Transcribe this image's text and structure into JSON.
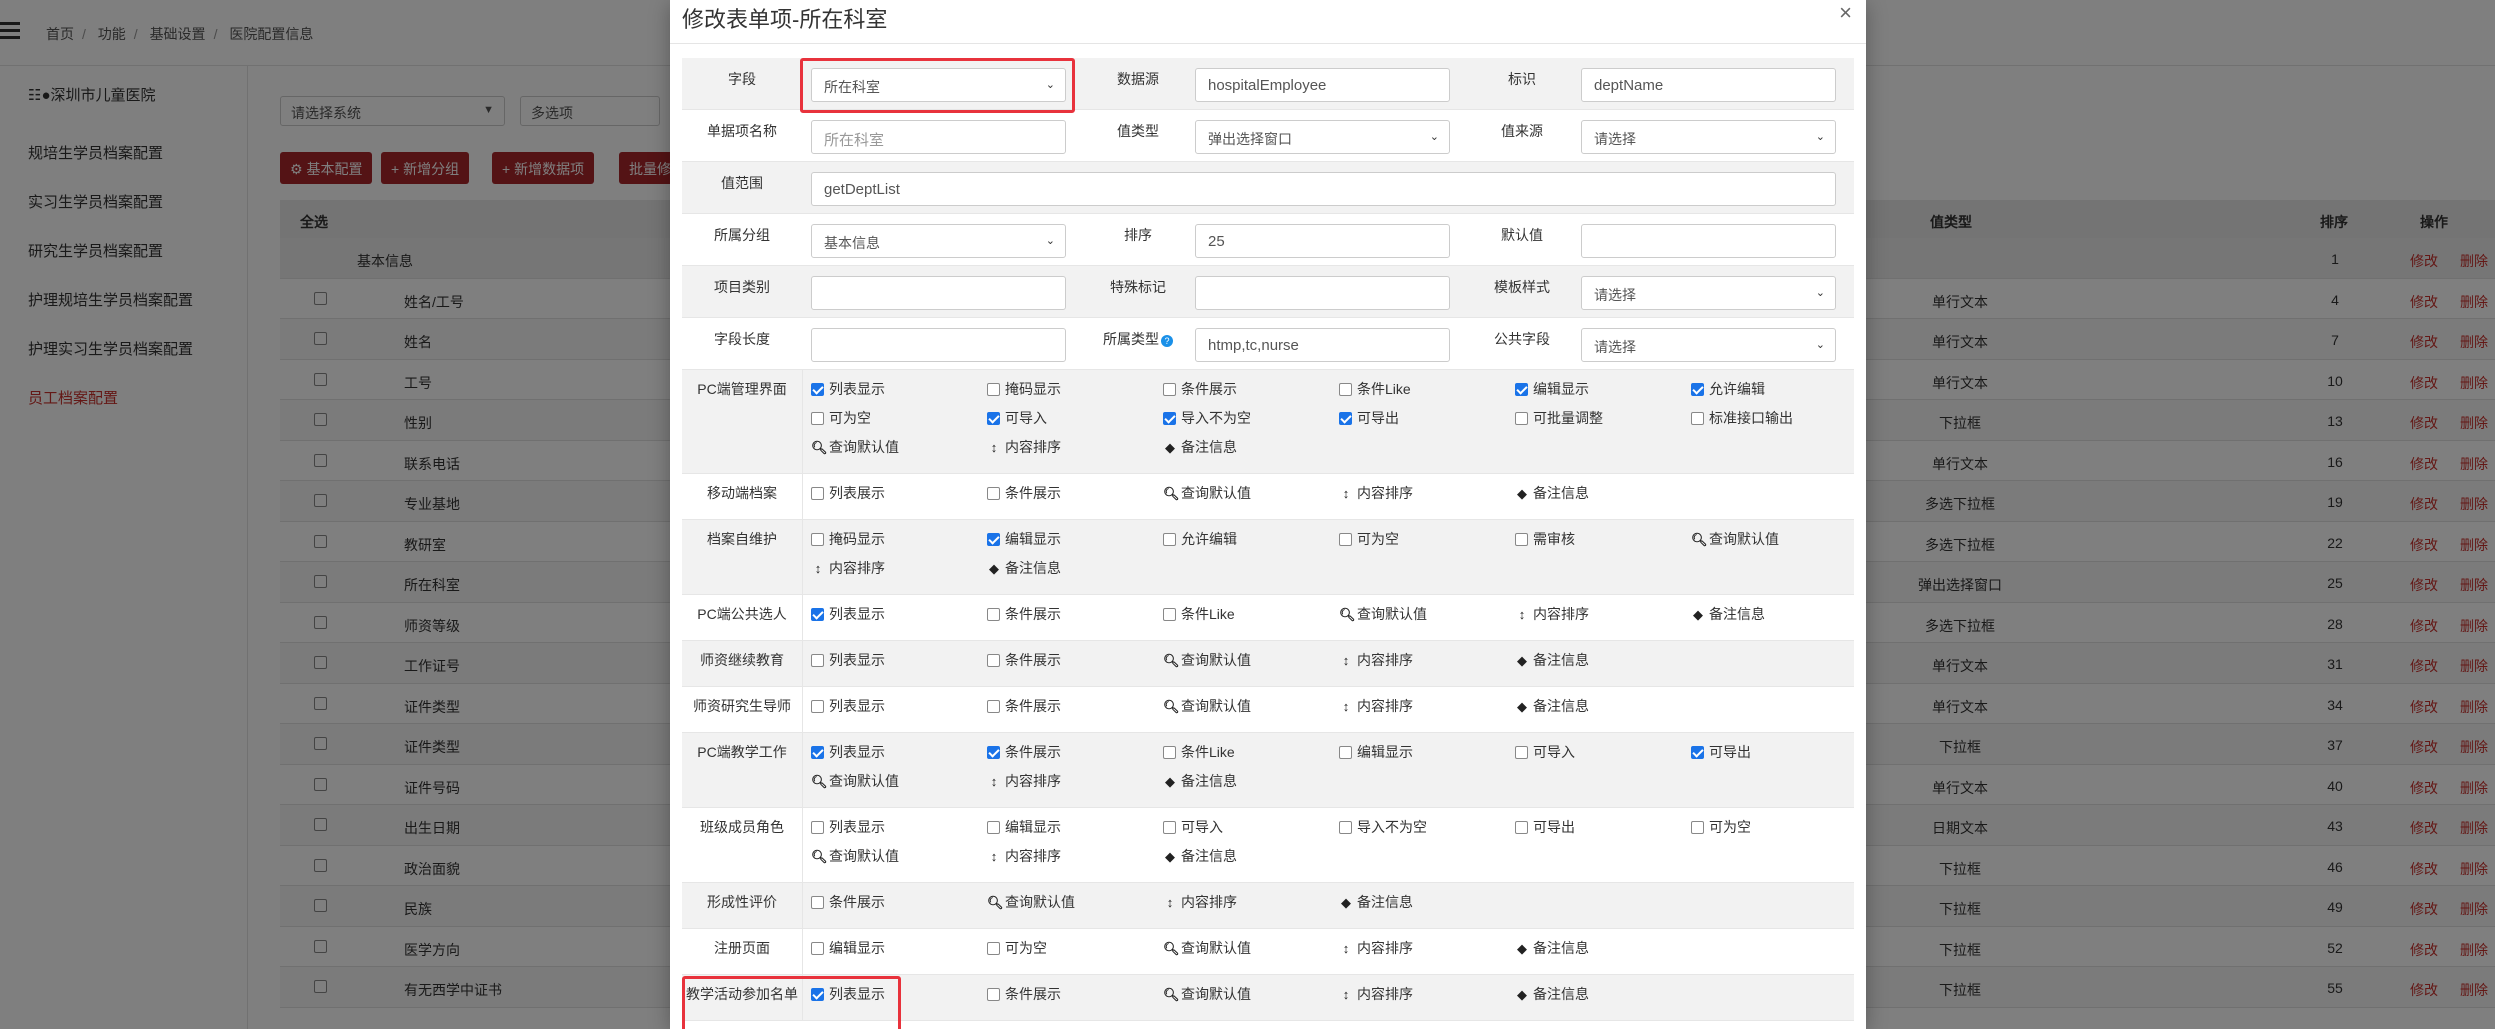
{
  "breadcrumb": [
    "首页",
    "功能",
    "基础设置",
    "医院配置信息"
  ],
  "sidebar": {
    "hospital": "深圳市儿童医院",
    "items": [
      {
        "label": "规培生学员档案配置",
        "active": false
      },
      {
        "label": "实习生学员档案配置",
        "active": false
      },
      {
        "label": "研究生学员档案配置",
        "active": false
      },
      {
        "label": "护理规培生学员档案配置",
        "active": false
      },
      {
        "label": "护理实习生学员档案配置",
        "active": false
      },
      {
        "label": "员工档案配置",
        "active": true
      }
    ]
  },
  "filters": {
    "system": "请选择系统",
    "multi": "多选项"
  },
  "buttons": {
    "basic": "基本配置",
    "add_group": "新增分组",
    "add_data": "新增数据项",
    "batch": "批量修改"
  },
  "table": {
    "headers": {
      "select_all": "全选",
      "value_type": "值类型",
      "sort": "排序",
      "action": "操作"
    },
    "group": {
      "name": "基本信息",
      "sort": "1"
    },
    "edit_label": "修改",
    "delete_label": "删除",
    "rows": [
      {
        "name": "姓名/工号",
        "type": "单行文本",
        "sort": "4"
      },
      {
        "name": "姓名",
        "type": "单行文本",
        "sort": "7"
      },
      {
        "name": "工号",
        "type": "单行文本",
        "sort": "10"
      },
      {
        "name": "性别",
        "type": "下拉框",
        "sort": "13"
      },
      {
        "name": "联系电话",
        "type": "单行文本",
        "sort": "16"
      },
      {
        "name": "专业基地",
        "type": "多选下拉框",
        "sort": "19"
      },
      {
        "name": "教研室",
        "type": "多选下拉框",
        "sort": "22"
      },
      {
        "name": "所在科室",
        "type": "弹出选择窗口",
        "sort": "25"
      },
      {
        "name": "师资等级",
        "type": "多选下拉框",
        "sort": "28"
      },
      {
        "name": "工作证号",
        "type": "单行文本",
        "sort": "31"
      },
      {
        "name": "证件类型",
        "type": "单行文本",
        "sort": "34"
      },
      {
        "name": "证件类型",
        "type": "下拉框",
        "sort": "37"
      },
      {
        "name": "证件号码",
        "type": "单行文本",
        "sort": "40"
      },
      {
        "name": "出生日期",
        "type": "日期文本",
        "sort": "43"
      },
      {
        "name": "政治面貌",
        "type": "下拉框",
        "sort": "46"
      },
      {
        "name": "民族",
        "type": "下拉框",
        "sort": "49"
      },
      {
        "name": "医学方向",
        "type": "下拉框",
        "sort": "52"
      },
      {
        "name": "有无西学中证书",
        "type": "下拉框",
        "sort": "55"
      }
    ]
  },
  "modal": {
    "title": "修改表单项-所在科室",
    "close": "×",
    "fields": {
      "field_label": "字段",
      "field_value": "所在科室",
      "datasource_label": "数据源",
      "datasource_value": "hospitalEmployee",
      "ident_label": "标识",
      "ident_value": "deptName",
      "itemname_label": "单据项名称",
      "itemname_placeholder": "所在科室",
      "valtype_label": "值类型",
      "valtype_value": "弹出选择窗口",
      "valsource_label": "值来源",
      "valsource_value": "请选择",
      "range_label": "值范围",
      "range_value": "getDeptList",
      "group_label": "所属分组",
      "group_value": "基本信息",
      "sort_label": "排序",
      "sort_value": "25",
      "default_label": "默认值",
      "default_value": "",
      "category_label": "项目类别",
      "category_value": "",
      "special_label": "特殊标记",
      "special_value": "",
      "template_label": "模板样式",
      "template_value": "请选择",
      "length_label": "字段长度",
      "length_value": "",
      "ownertype_label": "所属类型",
      "ownertype_value": "htmp,tc,nurse",
      "public_label": "公共字段",
      "public_value": "请选择"
    },
    "sections": [
      {
        "label": "PC端管理界面",
        "opts": [
          {
            "t": "列表显示",
            "k": "cb",
            "on": true
          },
          {
            "t": "掩码显示",
            "k": "cb",
            "on": false
          },
          {
            "t": "条件展示",
            "k": "cb",
            "on": false
          },
          {
            "t": "条件Like",
            "k": "cb",
            "on": false
          },
          {
            "t": "编辑显示",
            "k": "cb",
            "on": true
          },
          {
            "t": "允许编辑",
            "k": "cb",
            "on": true
          },
          {
            "t": "可为空",
            "k": "cb",
            "on": false
          },
          {
            "t": "可导入",
            "k": "cb",
            "on": true
          },
          {
            "t": "导入不为空",
            "k": "cb",
            "on": true
          },
          {
            "t": "可导出",
            "k": "cb",
            "on": true
          },
          {
            "t": "可批量调整",
            "k": "cb",
            "on": false
          },
          {
            "t": "标准接口输出",
            "k": "cb",
            "on": false
          },
          {
            "t": "查询默认值",
            "k": "search"
          },
          {
            "t": "内容排序",
            "k": "sort"
          },
          {
            "t": "备注信息",
            "k": "tag"
          }
        ]
      },
      {
        "label": "移动端档案",
        "opts": [
          {
            "t": "列表展示",
            "k": "cb",
            "on": false
          },
          {
            "t": "条件展示",
            "k": "cb",
            "on": false
          },
          {
            "t": "查询默认值",
            "k": "search"
          },
          {
            "t": "内容排序",
            "k": "sort"
          },
          {
            "t": "备注信息",
            "k": "tag"
          }
        ]
      },
      {
        "label": "档案自维护",
        "opts": [
          {
            "t": "掩码显示",
            "k": "cb",
            "on": false
          },
          {
            "t": "编辑显示",
            "k": "cb",
            "on": true
          },
          {
            "t": "允许编辑",
            "k": "cb",
            "on": false
          },
          {
            "t": "可为空",
            "k": "cb",
            "on": false
          },
          {
            "t": "需审核",
            "k": "cb",
            "on": false
          },
          {
            "t": "查询默认值",
            "k": "search"
          },
          {
            "t": "内容排序",
            "k": "sort"
          },
          {
            "t": "备注信息",
            "k": "tag"
          }
        ]
      },
      {
        "label": "PC端公共选人",
        "opts": [
          {
            "t": "列表显示",
            "k": "cb",
            "on": true
          },
          {
            "t": "条件展示",
            "k": "cb",
            "on": false
          },
          {
            "t": "条件Like",
            "k": "cb",
            "on": false
          },
          {
            "t": "查询默认值",
            "k": "search"
          },
          {
            "t": "内容排序",
            "k": "sort"
          },
          {
            "t": "备注信息",
            "k": "tag"
          }
        ]
      },
      {
        "label": "师资继续教育",
        "opts": [
          {
            "t": "列表显示",
            "k": "cb",
            "on": false
          },
          {
            "t": "条件展示",
            "k": "cb",
            "on": false
          },
          {
            "t": "查询默认值",
            "k": "search"
          },
          {
            "t": "内容排序",
            "k": "sort"
          },
          {
            "t": "备注信息",
            "k": "tag"
          }
        ]
      },
      {
        "label": "师资研究生导师",
        "opts": [
          {
            "t": "列表显示",
            "k": "cb",
            "on": false
          },
          {
            "t": "条件展示",
            "k": "cb",
            "on": false
          },
          {
            "t": "查询默认值",
            "k": "search"
          },
          {
            "t": "内容排序",
            "k": "sort"
          },
          {
            "t": "备注信息",
            "k": "tag"
          }
        ]
      },
      {
        "label": "PC端教学工作",
        "opts": [
          {
            "t": "列表显示",
            "k": "cb",
            "on": true
          },
          {
            "t": "条件展示",
            "k": "cb",
            "on": true
          },
          {
            "t": "条件Like",
            "k": "cb",
            "on": false
          },
          {
            "t": "编辑显示",
            "k": "cb",
            "on": false
          },
          {
            "t": "可导入",
            "k": "cb",
            "on": false
          },
          {
            "t": "可导出",
            "k": "cb",
            "on": true
          },
          {
            "t": "查询默认值",
            "k": "search"
          },
          {
            "t": "内容排序",
            "k": "sort"
          },
          {
            "t": "备注信息",
            "k": "tag"
          }
        ]
      },
      {
        "label": "班级成员角色",
        "opts": [
          {
            "t": "列表显示",
            "k": "cb",
            "on": false
          },
          {
            "t": "编辑显示",
            "k": "cb",
            "on": false
          },
          {
            "t": "可导入",
            "k": "cb",
            "on": false
          },
          {
            "t": "导入不为空",
            "k": "cb",
            "on": false
          },
          {
            "t": "可导出",
            "k": "cb",
            "on": false
          },
          {
            "t": "可为空",
            "k": "cb",
            "on": false
          },
          {
            "t": "查询默认值",
            "k": "search"
          },
          {
            "t": "内容排序",
            "k": "sort"
          },
          {
            "t": "备注信息",
            "k": "tag"
          }
        ]
      },
      {
        "label": "形成性评价",
        "opts": [
          {
            "t": "条件展示",
            "k": "cb",
            "on": false
          },
          {
            "t": "查询默认值",
            "k": "search"
          },
          {
            "t": "内容排序",
            "k": "sort"
          },
          {
            "t": "备注信息",
            "k": "tag"
          }
        ]
      },
      {
        "label": "注册页面",
        "opts": [
          {
            "t": "编辑显示",
            "k": "cb",
            "on": false
          },
          {
            "t": "可为空",
            "k": "cb",
            "on": false
          },
          {
            "t": "查询默认值",
            "k": "search"
          },
          {
            "t": "内容排序",
            "k": "sort"
          },
          {
            "t": "备注信息",
            "k": "tag"
          }
        ]
      },
      {
        "label": "教学活动参加名单",
        "opts": [
          {
            "t": "列表显示",
            "k": "cb",
            "on": true
          },
          {
            "t": "条件展示",
            "k": "cb",
            "on": false
          },
          {
            "t": "查询默认值",
            "k": "search"
          },
          {
            "t": "内容排序",
            "k": "sort"
          },
          {
            "t": "备注信息",
            "k": "tag"
          }
        ]
      }
    ]
  },
  "colors": {
    "primary": "#a8262b",
    "link": "#c9302c",
    "highlight": "#e8323c",
    "checked": "#1a73e8"
  }
}
